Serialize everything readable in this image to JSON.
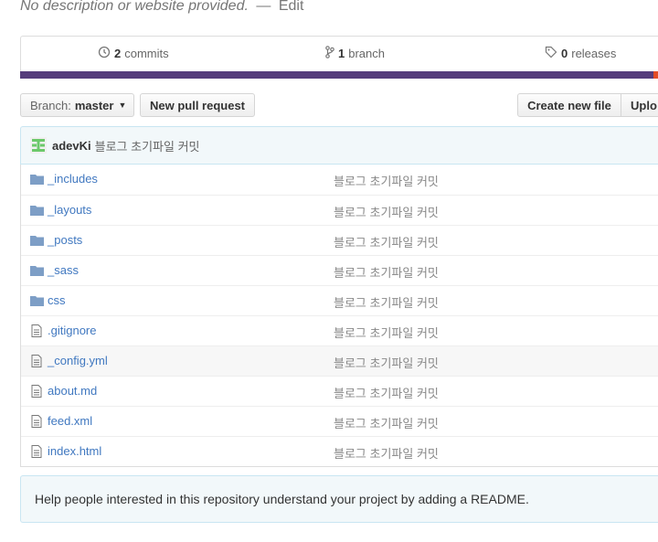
{
  "repo": {
    "description": "No description or website provided.",
    "separator": "—",
    "edit_label": "Edit"
  },
  "summary": {
    "commits_count": "2",
    "commits_label": "commits",
    "branches_count": "1",
    "branches_label": "branch",
    "releases_count": "0",
    "releases_label": "releases"
  },
  "language_colors": {
    "primary": "#563d7c",
    "secondary": "#e34c26"
  },
  "toolbar": {
    "branch_prefix": "Branch:",
    "branch_name": "master",
    "new_pr_label": "New pull request",
    "create_file_label": "Create new file",
    "upload_label": "Uplo"
  },
  "latest_commit": {
    "author": "adevKi",
    "message": "블로그 초기파일 커밋"
  },
  "files": [
    {
      "type": "folder",
      "name": "_includes",
      "message": "블로그 초기파일 커밋"
    },
    {
      "type": "folder",
      "name": "_layouts",
      "message": "블로그 초기파일 커밋"
    },
    {
      "type": "folder",
      "name": "_posts",
      "message": "블로그 초기파일 커밋"
    },
    {
      "type": "folder",
      "name": "_sass",
      "message": "블로그 초기파일 커밋"
    },
    {
      "type": "folder",
      "name": "css",
      "message": "블로그 초기파일 커밋"
    },
    {
      "type": "file",
      "name": ".gitignore",
      "message": "블로그 초기파일 커밋"
    },
    {
      "type": "file",
      "name": "_config.yml",
      "message": "블로그 초기파일 커밋"
    },
    {
      "type": "file",
      "name": "about.md",
      "message": "블로그 초기파일 커밋"
    },
    {
      "type": "file",
      "name": "feed.xml",
      "message": "블로그 초기파일 커밋"
    },
    {
      "type": "file",
      "name": "index.html",
      "message": "블로그 초기파일 커밋"
    }
  ],
  "readme_prompt": "Help people interested in this repository understand your project by adding a README."
}
